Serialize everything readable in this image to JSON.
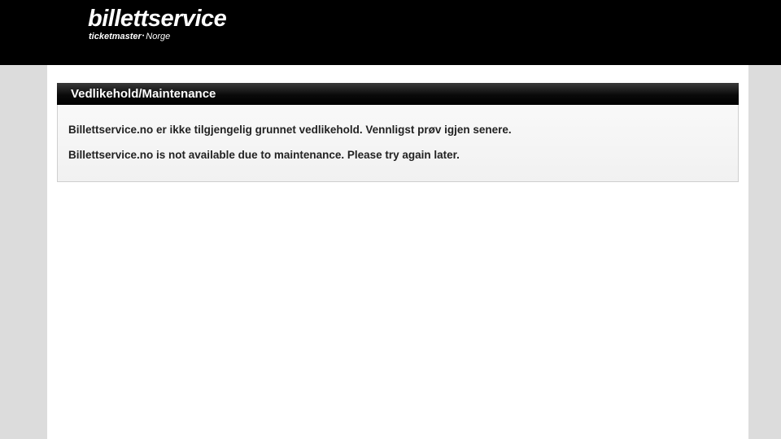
{
  "header": {
    "logo_main": "billettservice",
    "logo_sub_brand": "ticketmaster",
    "logo_sub_dot": "•",
    "logo_sub_country": "Norge"
  },
  "notice": {
    "title": "Vedlikehold/Maintenance",
    "message_no": "Billettservice.no er ikke tilgjengelig grunnet vedlikehold. Vennligst prøv igjen senere.",
    "message_en": "Billettservice.no is not available due to maintenance. Please try again later."
  },
  "colors": {
    "header_bg": "#000000",
    "page_bg": "#dcdcdc",
    "content_bg": "#ffffff",
    "panel_header_bg": "#000000",
    "text": "#222222"
  }
}
